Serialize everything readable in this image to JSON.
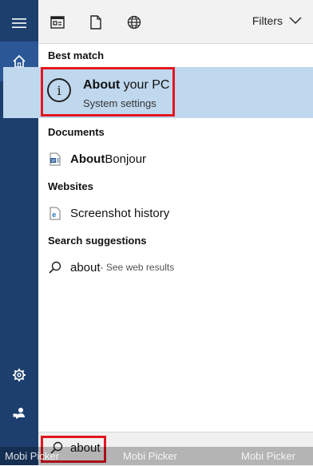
{
  "toolbar": {
    "filters_label": "Filters"
  },
  "sections": {
    "best_match": "Best match",
    "documents": "Documents",
    "websites": "Websites",
    "search_suggestions": "Search suggestions"
  },
  "best_match_item": {
    "title_bold": "About",
    "title_rest": " your PC",
    "subtitle": "System settings"
  },
  "documents": [
    {
      "bold": "About",
      "rest": " Bonjour"
    }
  ],
  "websites": [
    {
      "label": "Screenshot history"
    }
  ],
  "suggestions": [
    {
      "term": "about",
      "hint": " - See web results"
    }
  ],
  "search": {
    "value": "about"
  },
  "watermark": {
    "text1": "Mobi Picker",
    "text2": "Mobi Picker",
    "text3": "Mobi Picker"
  },
  "colors": {
    "rail": "#1d3f6e",
    "rail_selected": "#2b5797",
    "highlight": "#c0d8ee",
    "annotation": "#e2161f"
  },
  "icons": {
    "menu": "hamburger-icon",
    "home": "home-icon",
    "notebook": "notebook-icon",
    "settings": "settings-gear-icon",
    "feedback": "feedback-icon",
    "apps": "apps-icon",
    "documents": "document-icon",
    "web": "globe-icon"
  }
}
